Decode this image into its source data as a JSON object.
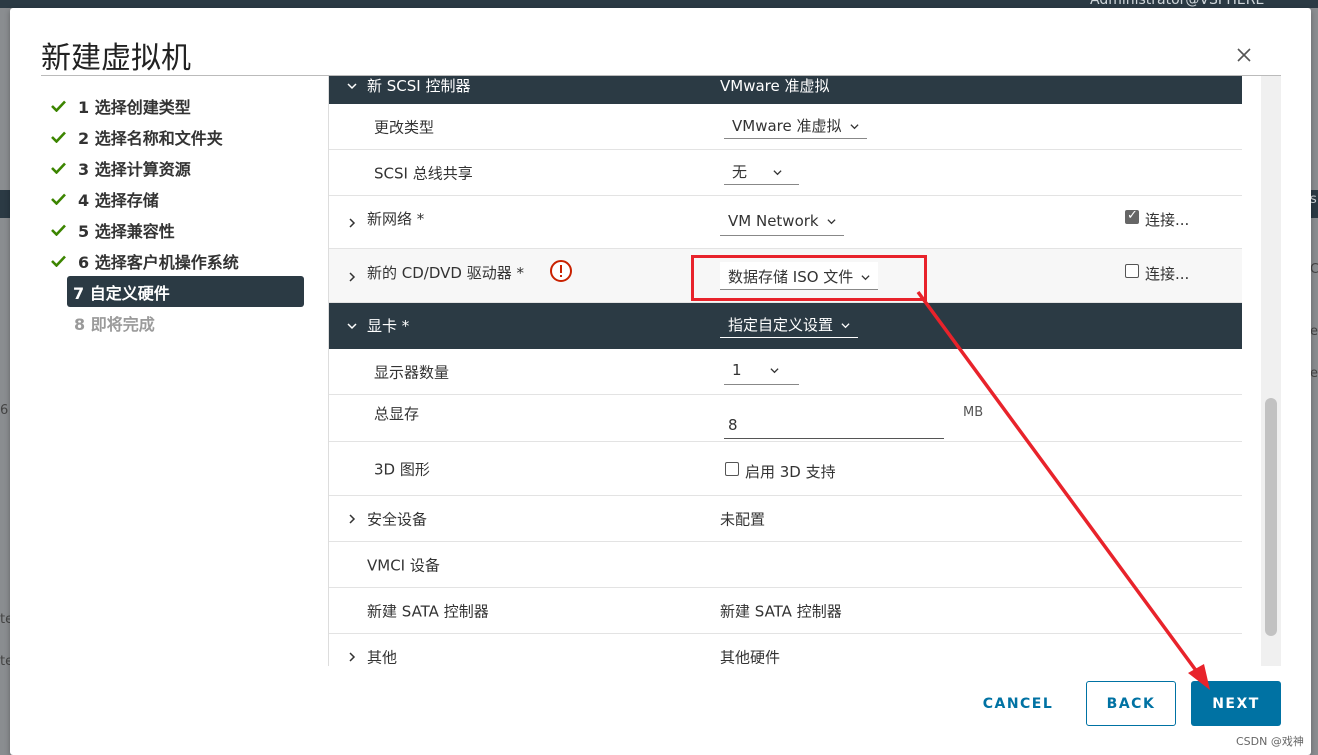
{
  "background": {
    "user_text": "Administrator@VSPHERE",
    "left_glyphs": [
      "6",
      "te",
      "te"
    ],
    "right_glyphs": [
      "C",
      "e",
      "e",
      "s"
    ]
  },
  "dialog": {
    "title": "新建虚拟机",
    "close_icon": "close-icon"
  },
  "steps": [
    {
      "label": "1 选择创建类型",
      "state": "done"
    },
    {
      "label": "2 选择名称和文件夹",
      "state": "done"
    },
    {
      "label": "3 选择计算资源",
      "state": "done"
    },
    {
      "label": "4 选择存储",
      "state": "done"
    },
    {
      "label": "5 选择兼容性",
      "state": "done"
    },
    {
      "label": "6 选择客户机操作系统",
      "state": "done"
    },
    {
      "label": "7 自定义硬件",
      "state": "active"
    },
    {
      "label": "8 即将完成",
      "state": "pending"
    }
  ],
  "hardware": {
    "scsi_header_label": "新 SCSI 控制器",
    "scsi_header_value": "VMware 准虚拟",
    "change_type_label": "更改类型",
    "change_type_value": "VMware 准虚拟",
    "scsi_bus_label": "SCSI 总线共享",
    "scsi_bus_value": "无",
    "network_label": "新网络 *",
    "network_value": "VM Network",
    "network_connect_label": "连接...",
    "network_connected": true,
    "cd_label": "新的 CD/DVD 驱动器 *",
    "cd_value": "数据存储 ISO 文件",
    "cd_connect_label": "连接...",
    "cd_connected": false,
    "video_label": "显卡 *",
    "video_value": "指定自定义设置",
    "displays_label": "显示器数量",
    "displays_value": "1",
    "vram_label": "总显存",
    "vram_value": "8",
    "vram_unit": "MB",
    "graphics3d_label": "3D 图形",
    "graphics3d_checkbox_label": "启用 3D 支持",
    "security_label": "安全设备",
    "security_value": "未配置",
    "vmci_label": "VMCI 设备",
    "sata_label": "新建 SATA 控制器",
    "sata_value": "新建 SATA 控制器",
    "other_label": "其他",
    "other_value": "其他硬件"
  },
  "footer": {
    "cancel": "CANCEL",
    "back": "BACK",
    "next": "NEXT"
  },
  "watermark": "CSDN @戏神",
  "colors": {
    "header_dark": "#2b3a44",
    "primary": "#0072a3",
    "check_green": "#3c8500",
    "annotation_red": "#e8232b",
    "warning_red": "#c92100"
  }
}
